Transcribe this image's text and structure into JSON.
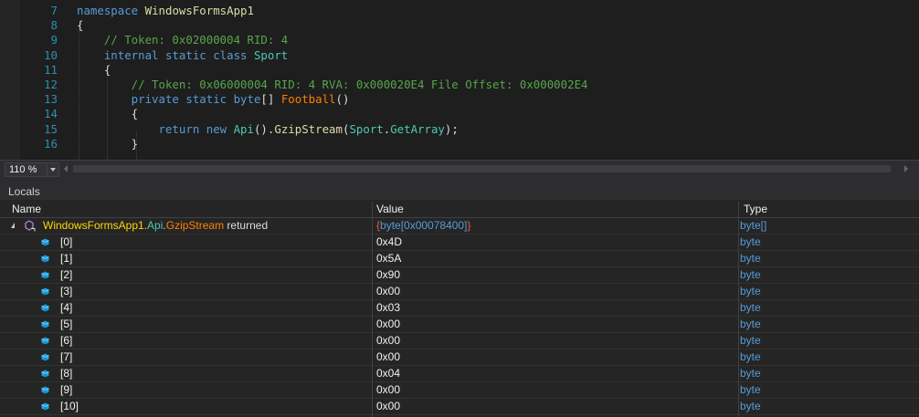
{
  "editor": {
    "lines": [
      {
        "num": "7",
        "parts": [
          {
            "t": "namespace ",
            "c": "kw"
          },
          {
            "t": "WindowsFormsApp1",
            "c": "mth"
          }
        ]
      },
      {
        "num": "8",
        "parts": [
          {
            "t": "{",
            "c": "pl"
          }
        ]
      },
      {
        "num": "9",
        "parts": [
          {
            "t": "    // Token: 0x02000004 RID: 4",
            "c": "cm"
          }
        ]
      },
      {
        "num": "10",
        "parts": [
          {
            "t": "    internal static class ",
            "c": "kw"
          },
          {
            "t": "Sport",
            "c": "ty"
          }
        ]
      },
      {
        "num": "11",
        "parts": [
          {
            "t": "    {",
            "c": "pl"
          }
        ]
      },
      {
        "num": "12",
        "parts": [
          {
            "t": "        // Token: 0x06000004 RID: 4 RVA: 0x000020E4 File Offset: 0x000002E4",
            "c": "cm"
          }
        ]
      },
      {
        "num": "13",
        "parts": [
          {
            "t": "        private static byte",
            "c": "kw"
          },
          {
            "t": "[] ",
            "c": "pl"
          },
          {
            "t": "Football",
            "c": "org"
          },
          {
            "t": "()",
            "c": "pl"
          }
        ]
      },
      {
        "num": "14",
        "parts": [
          {
            "t": "        {",
            "c": "pl"
          }
        ]
      },
      {
        "num": "15",
        "parts": [
          {
            "t": "            return new ",
            "c": "kw"
          },
          {
            "t": "Api",
            "c": "ty"
          },
          {
            "t": "().",
            "c": "pl"
          },
          {
            "t": "GzipStream",
            "c": "mth"
          },
          {
            "t": "(",
            "c": "pl"
          },
          {
            "t": "Sport",
            "c": "ty"
          },
          {
            "t": ".",
            "c": "pl"
          },
          {
            "t": "GetArray",
            "c": "ty"
          },
          {
            "t": ");",
            "c": "pl"
          }
        ]
      },
      {
        "num": "16",
        "parts": [
          {
            "t": "        }",
            "c": "pl"
          }
        ]
      }
    ]
  },
  "zoom": {
    "value": "110 %"
  },
  "locals": {
    "title": "Locals",
    "columns": {
      "name": "Name",
      "value": "Value",
      "type": "Type"
    },
    "returned": {
      "ns": "WindowsFormsApp1.",
      "cls": "Api",
      "dot": ".",
      "method": "GzipStream",
      "suffix": " returned",
      "value_open": "{",
      "value_inner": "byte[0x00078400]",
      "value_close": "}",
      "type": "byte[]"
    },
    "items": [
      {
        "index": "[0]",
        "value": "0x4D",
        "type": "byte"
      },
      {
        "index": "[1]",
        "value": "0x5A",
        "type": "byte"
      },
      {
        "index": "[2]",
        "value": "0x90",
        "type": "byte"
      },
      {
        "index": "[3]",
        "value": "0x00",
        "type": "byte"
      },
      {
        "index": "[4]",
        "value": "0x03",
        "type": "byte"
      },
      {
        "index": "[5]",
        "value": "0x00",
        "type": "byte"
      },
      {
        "index": "[6]",
        "value": "0x00",
        "type": "byte"
      },
      {
        "index": "[7]",
        "value": "0x00",
        "type": "byte"
      },
      {
        "index": "[8]",
        "value": "0x04",
        "type": "byte"
      },
      {
        "index": "[9]",
        "value": "0x00",
        "type": "byte"
      },
      {
        "index": "[10]",
        "value": "0x00",
        "type": "byte"
      }
    ]
  },
  "icons": {
    "field": "field-cube-icon",
    "returned": "return-value-icon",
    "expander": "expander-icon"
  }
}
